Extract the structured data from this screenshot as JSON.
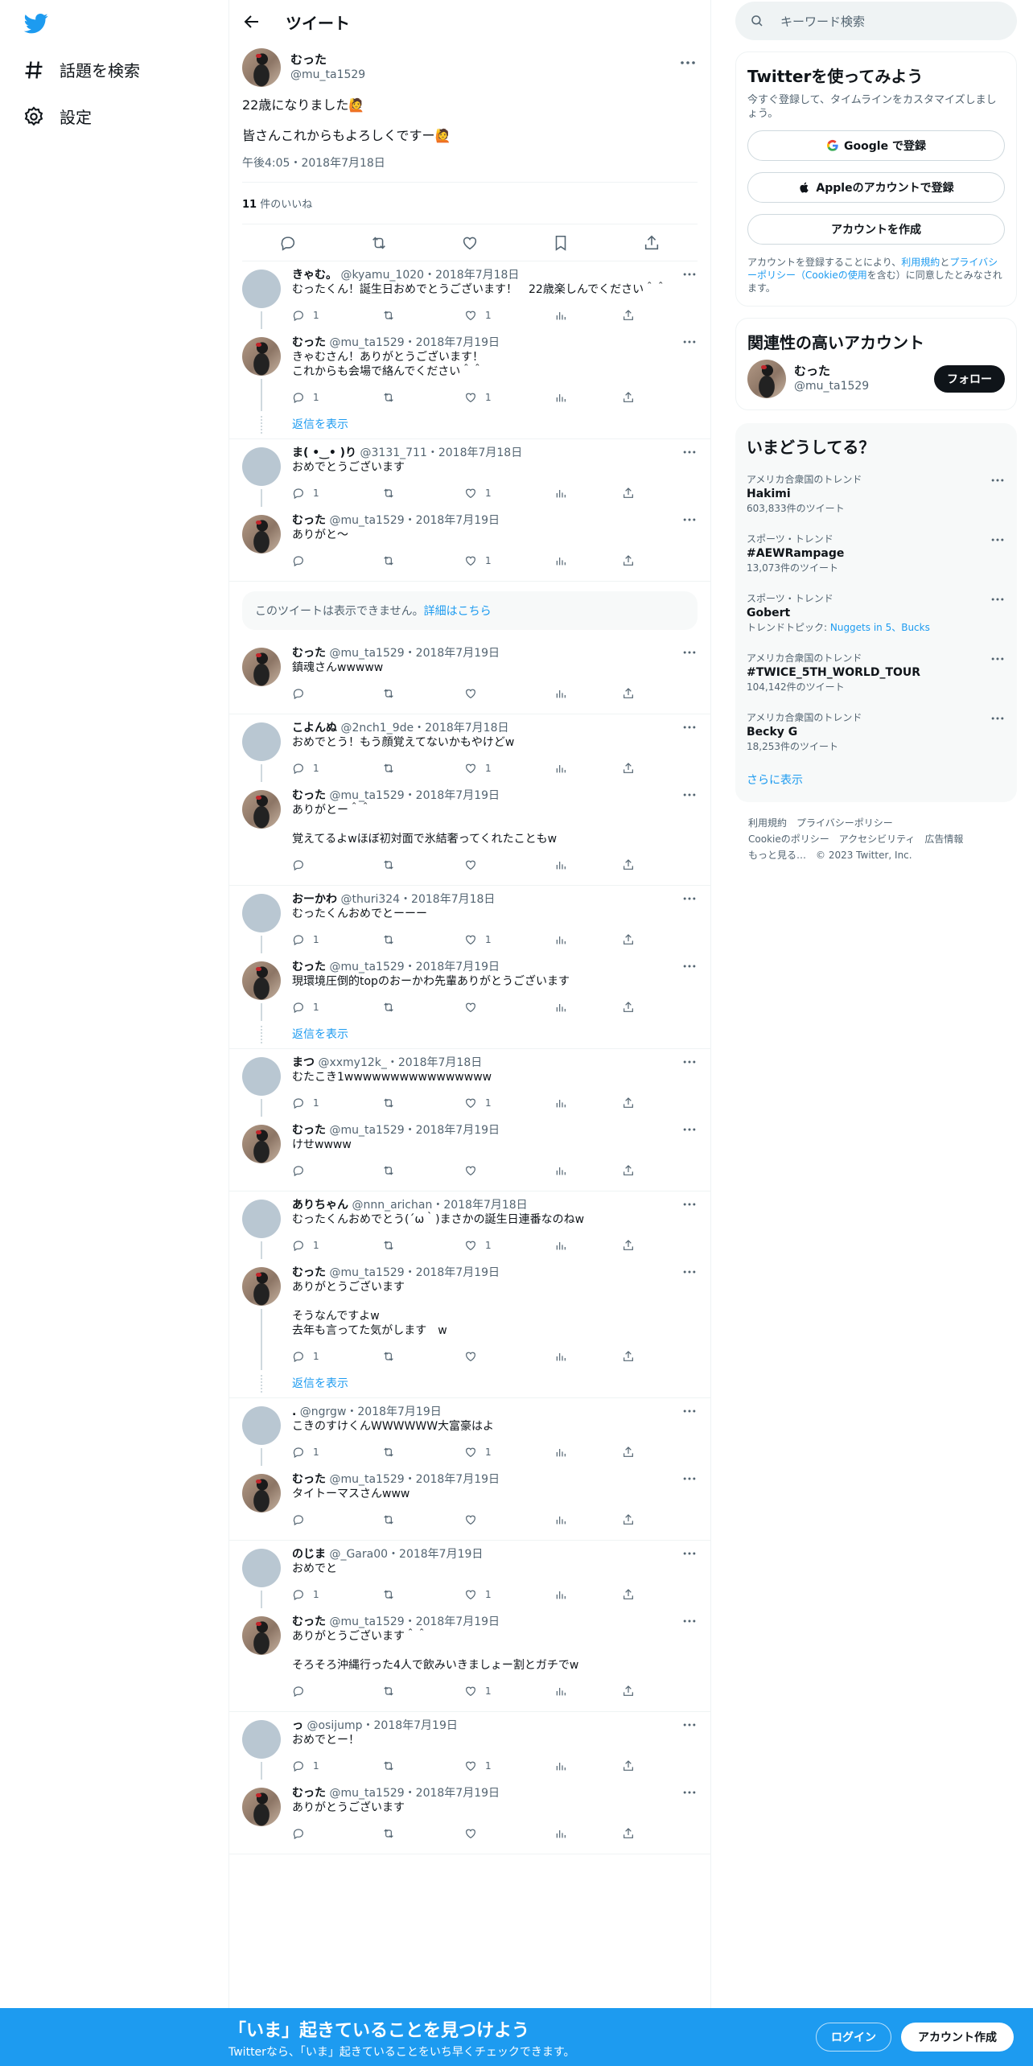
{
  "nav": {
    "explore_label": "話題を検索",
    "settings_label": "設定"
  },
  "header": {
    "title": "ツイート"
  },
  "focal": {
    "name": "むった",
    "handle": "@mu_ta1529",
    "line1": "22歳になりました🙋",
    "line2": "皆さんこれからもよろしくですー🙋",
    "time": "午後4:05・2018年7月18日",
    "likes_count": "11",
    "likes_label": " 件のいいね"
  },
  "groups": [
    {
      "replies": [
        {
          "name": "きゃむ。",
          "handle": "@kyamu_1020",
          "date": "・2018年7月18日",
          "text": "むったくん！誕生日おめでとうございます！　22歳楽しんでください＾＾",
          "avatar": "gray",
          "replies": "1",
          "likes": "1"
        },
        {
          "name": "むった",
          "handle": "@mu_ta1529",
          "date": "・2018年7月19日",
          "text": "きゃむさん！ありがとうございます！\nこれからも会場で絡んでください＾＾",
          "avatar": "m",
          "replies": "1",
          "likes": "1"
        }
      ],
      "show_more": "返信を表示"
    },
    {
      "replies": [
        {
          "name": "ま( •‿• )り",
          "handle": "@3131_711",
          "date": "・2018年7月18日",
          "text": "おめでとうございます",
          "avatar": "gray",
          "replies": "1",
          "likes": "1"
        },
        {
          "name": "むった",
          "handle": "@mu_ta1529",
          "date": "・2018年7月19日",
          "text": "ありがと〜",
          "avatar": "m",
          "replies": "",
          "likes": "1"
        }
      ]
    },
    {
      "notice": {
        "text": "このツイートは表示できません。",
        "link": "詳細はこちら"
      },
      "replies": [
        {
          "name": "むった",
          "handle": "@mu_ta1529",
          "date": "・2018年7月19日",
          "text": "鎮魂さんwwwww",
          "avatar": "m",
          "replies": "",
          "likes": ""
        }
      ]
    },
    {
      "replies": [
        {
          "name": "こよんぬ",
          "handle": "@2nch1_9de",
          "date": "・2018年7月18日",
          "text": "おめでとう！もう顔覚えてないかもやけどw",
          "avatar": "gray",
          "replies": "1",
          "likes": "1"
        },
        {
          "name": "むった",
          "handle": "@mu_ta1529",
          "date": "・2018年7月19日",
          "text": "ありがとー＾＾\n\n覚えてるよwほぼ初対面で氷結奢ってくれたこともw",
          "avatar": "m",
          "replies": "",
          "likes": ""
        }
      ]
    },
    {
      "replies": [
        {
          "name": "おーかわ",
          "handle": "@thuri324",
          "date": "・2018年7月18日",
          "text": "むったくんおめでとーーー",
          "avatar": "gray",
          "replies": "1",
          "likes": "1"
        },
        {
          "name": "むった",
          "handle": "@mu_ta1529",
          "date": "・2018年7月19日",
          "text": "現環境圧倒的topのおーかわ先輩ありがとうございます",
          "avatar": "m",
          "replies": "1",
          "likes": ""
        }
      ],
      "show_more": "返信を表示"
    },
    {
      "replies": [
        {
          "name": "まつ",
          "handle": "@xxmy12k_",
          "date": "・2018年7月18日",
          "text": "むたこき1wwwwwwwwwwwwwwww",
          "avatar": "gray",
          "replies": "1",
          "likes": "1"
        },
        {
          "name": "むった",
          "handle": "@mu_ta1529",
          "date": "・2018年7月19日",
          "text": "けせwwww",
          "avatar": "m",
          "replies": "",
          "likes": ""
        }
      ]
    },
    {
      "replies": [
        {
          "name": "ありちゃん",
          "handle": "@nnn_arichan",
          "date": "・2018年7月18日",
          "text": "むったくんおめでとう(´ω｀)まさかの誕生日連番なのねw",
          "avatar": "gray",
          "replies": "1",
          "likes": "1"
        },
        {
          "name": "むった",
          "handle": "@mu_ta1529",
          "date": "・2018年7月19日",
          "text": "ありがとうございます\n\nそうなんですよw\n去年も言ってた気がします　w",
          "avatar": "m",
          "replies": "1",
          "likes": ""
        }
      ],
      "show_more": "返信を表示"
    },
    {
      "replies": [
        {
          "name": ".",
          "handle": "@ngrgw",
          "date": "・2018年7月19日",
          "text": "こきのすけくんWWWWWW大富豪はよ",
          "avatar": "gray",
          "replies": "1",
          "likes": "1"
        },
        {
          "name": "むった",
          "handle": "@mu_ta1529",
          "date": "・2018年7月19日",
          "text": "タイトーマスさんwww",
          "avatar": "m",
          "replies": "",
          "likes": ""
        }
      ]
    },
    {
      "replies": [
        {
          "name": "のじま",
          "handle": "@_Gara00",
          "date": "・2018年7月19日",
          "text": "おめでと",
          "avatar": "gray",
          "replies": "1",
          "likes": "1"
        },
        {
          "name": "むった",
          "handle": "@mu_ta1529",
          "date": "・2018年7月19日",
          "text": "ありがとうございます＾＾\n\nそろそろ沖縄行った4人で飲みいきましょー割とガチでw",
          "avatar": "m",
          "replies": "",
          "likes": "1"
        }
      ]
    },
    {
      "replies": [
        {
          "name": "っ",
          "handle": "@osijump",
          "date": "・2018年7月19日",
          "text": "おめでとー！",
          "avatar": "gray",
          "replies": "1",
          "likes": "1"
        },
        {
          "name": "むった",
          "handle": "@mu_ta1529",
          "date": "・2018年7月19日",
          "text": "ありがとうございます",
          "avatar": "m",
          "replies": "",
          "likes": ""
        }
      ]
    }
  ],
  "right": {
    "search_placeholder": "キーワード検索",
    "signup_card": {
      "title": "Twitterを使ってみよう",
      "desc": "今すぐ登録して、タイムラインをカスタマイズしましょう。",
      "google": "Google で登録",
      "apple": "Appleのアカウントで登録",
      "create": "アカウントを作成",
      "legal_pre": "アカウントを登録することにより、",
      "legal_terms": "利用規約",
      "legal_and": "と",
      "legal_privacy": "プライバシーポリシー",
      "legal_cookie": "（Cookieの使用",
      "legal_post": "を含む）に同意したとみなされます。"
    },
    "related": {
      "title": "関連性の高いアカウント",
      "name": "むった",
      "handle": "@mu_ta1529",
      "follow": "フォロー"
    },
    "trends": {
      "title": "いまどうしてる？",
      "items": [
        {
          "context": "アメリカ合衆国のトレンド",
          "name": "Hakimi",
          "count": "603,833件のツイート"
        },
        {
          "context": "スポーツ・トレンド",
          "name": "#AEWRampage",
          "count": "13,073件のツイート"
        },
        {
          "context": "スポーツ・トレンド",
          "name": "Gobert",
          "count": "トレンドトピック: ",
          "topics": "Nuggets in 5、Bucks"
        },
        {
          "context": "アメリカ合衆国のトレンド",
          "name": "#TWICE_5TH_WORLD_TOUR",
          "count": "104,142件のツイート"
        },
        {
          "context": "アメリカ合衆国のトレンド",
          "name": "Becky G",
          "count": "18,253件のツイート"
        }
      ],
      "more": "さらに表示"
    },
    "footer": {
      "terms": "利用規約",
      "privacy": "プライバシーポリシー",
      "cookie": "Cookieのポリシー",
      "access": "アクセシビリティ",
      "ads": "広告情報",
      "more": "もっと見る…",
      "copyright": "© 2023 Twitter, Inc."
    }
  },
  "banner": {
    "title": "「いま」起きていることを見つけよう",
    "subtitle": "Twitterなら、「いま」起きていることをいち早くチェックできます。",
    "login": "ログイン",
    "signup": "アカウント作成"
  },
  "colors": {
    "brand": "#1d9bf0",
    "text": "#0f1419",
    "muted": "#536471"
  }
}
